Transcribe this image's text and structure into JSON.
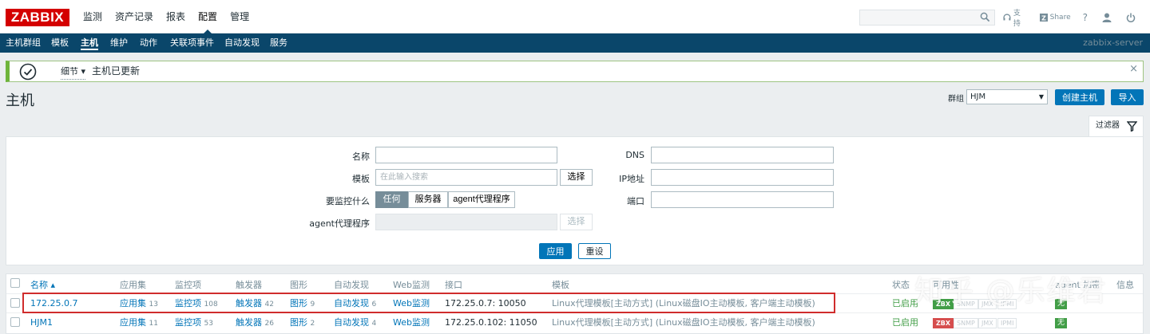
{
  "header": {
    "logo": "ZABBIX",
    "menu": [
      "监测",
      "资产记录",
      "报表",
      "配置",
      "管理"
    ],
    "active_menu_index": 3,
    "search_placeholder": "",
    "support": "支持",
    "share": "Share",
    "help": "?",
    "icons": [
      "search-icon",
      "headset-icon",
      "share-icon",
      "help-icon",
      "user-icon",
      "power-icon"
    ]
  },
  "submenu": {
    "items": [
      "主机群组",
      "模板",
      "主机",
      "维护",
      "动作",
      "关联项事件",
      "自动发现",
      "服务"
    ],
    "active_index": 2,
    "server": "zabbix-server"
  },
  "message": {
    "details": "细节 ▾",
    "text": "主机已更新",
    "close": "×"
  },
  "page": {
    "title": "主机",
    "group_label": "群组",
    "group_value": "HJM",
    "create_button": "创建主机",
    "import_button": "导入"
  },
  "filter": {
    "tab_label": "过滤器",
    "name_label": "名称",
    "name_value": "",
    "template_label": "模板",
    "template_placeholder": "在此输入搜索",
    "select_button": "选择",
    "monitored_by_label": "要监控什么",
    "monitored_by_options": [
      "任何",
      "服务器",
      "agent代理程序"
    ],
    "monitored_by_selected": 0,
    "proxy_label": "agent代理程序",
    "proxy_select_button": "选择",
    "dns_label": "DNS",
    "ip_label": "IP地址",
    "port_label": "端口",
    "apply_button": "应用",
    "reset_button": "重设"
  },
  "table": {
    "headers": {
      "name": "名称 ▴",
      "applications": "应用集",
      "items": "监控项",
      "triggers": "触发器",
      "graphs": "图形",
      "discovery": "自动发现",
      "web": "Web监测",
      "interface": "接口",
      "templates": "模板",
      "status": "状态",
      "availability": "可用性",
      "encryption": "agent 加密",
      "info": "信息"
    },
    "rows": [
      {
        "name": "172.25.0.7",
        "applications": "应用集",
        "applications_count": "13",
        "items": "监控项",
        "items_count": "108",
        "triggers": "触发器",
        "triggers_count": "42",
        "graphs": "图形",
        "graphs_count": "9",
        "discovery": "自动发现",
        "discovery_count": "6",
        "web": "Web监测",
        "interface": "172.25.0.7: 10050",
        "templates": "Linux代理模板[主动方式] (Linux磁盘IO主动模板, 客户端主动模板)",
        "status": "已启用",
        "zbx": "ZBX",
        "zbx_state": "ok",
        "snmp": "SNMP",
        "jmx": "JMX",
        "ipmi": "IPMI",
        "encryption": "无"
      },
      {
        "name": "HJM1",
        "applications": "应用集",
        "applications_count": "11",
        "items": "监控项",
        "items_count": "53",
        "triggers": "触发器",
        "triggers_count": "26",
        "graphs": "图形",
        "graphs_count": "2",
        "discovery": "自动发现",
        "discovery_count": "4",
        "web": "Web监测",
        "interface": "172.25.0.102: 11050",
        "templates": "Linux代理模板[主动方式] (Linux磁盘IO主动模板, 客户端主动模板)",
        "status": "已启用",
        "zbx": "ZBX",
        "zbx_state": "error",
        "snmp": "SNMP",
        "jmx": "JMX",
        "ipmi": "IPMI",
        "encryption": "无"
      }
    ]
  },
  "watermark": "知乎 @乐维君",
  "colors": {
    "brand_red": "#d40000",
    "nav_blue": "#0a466a",
    "link_blue": "#0275b8",
    "success_green": "#429e47",
    "error_red": "#d64e4e",
    "highlight_red": "#d02c2c"
  }
}
